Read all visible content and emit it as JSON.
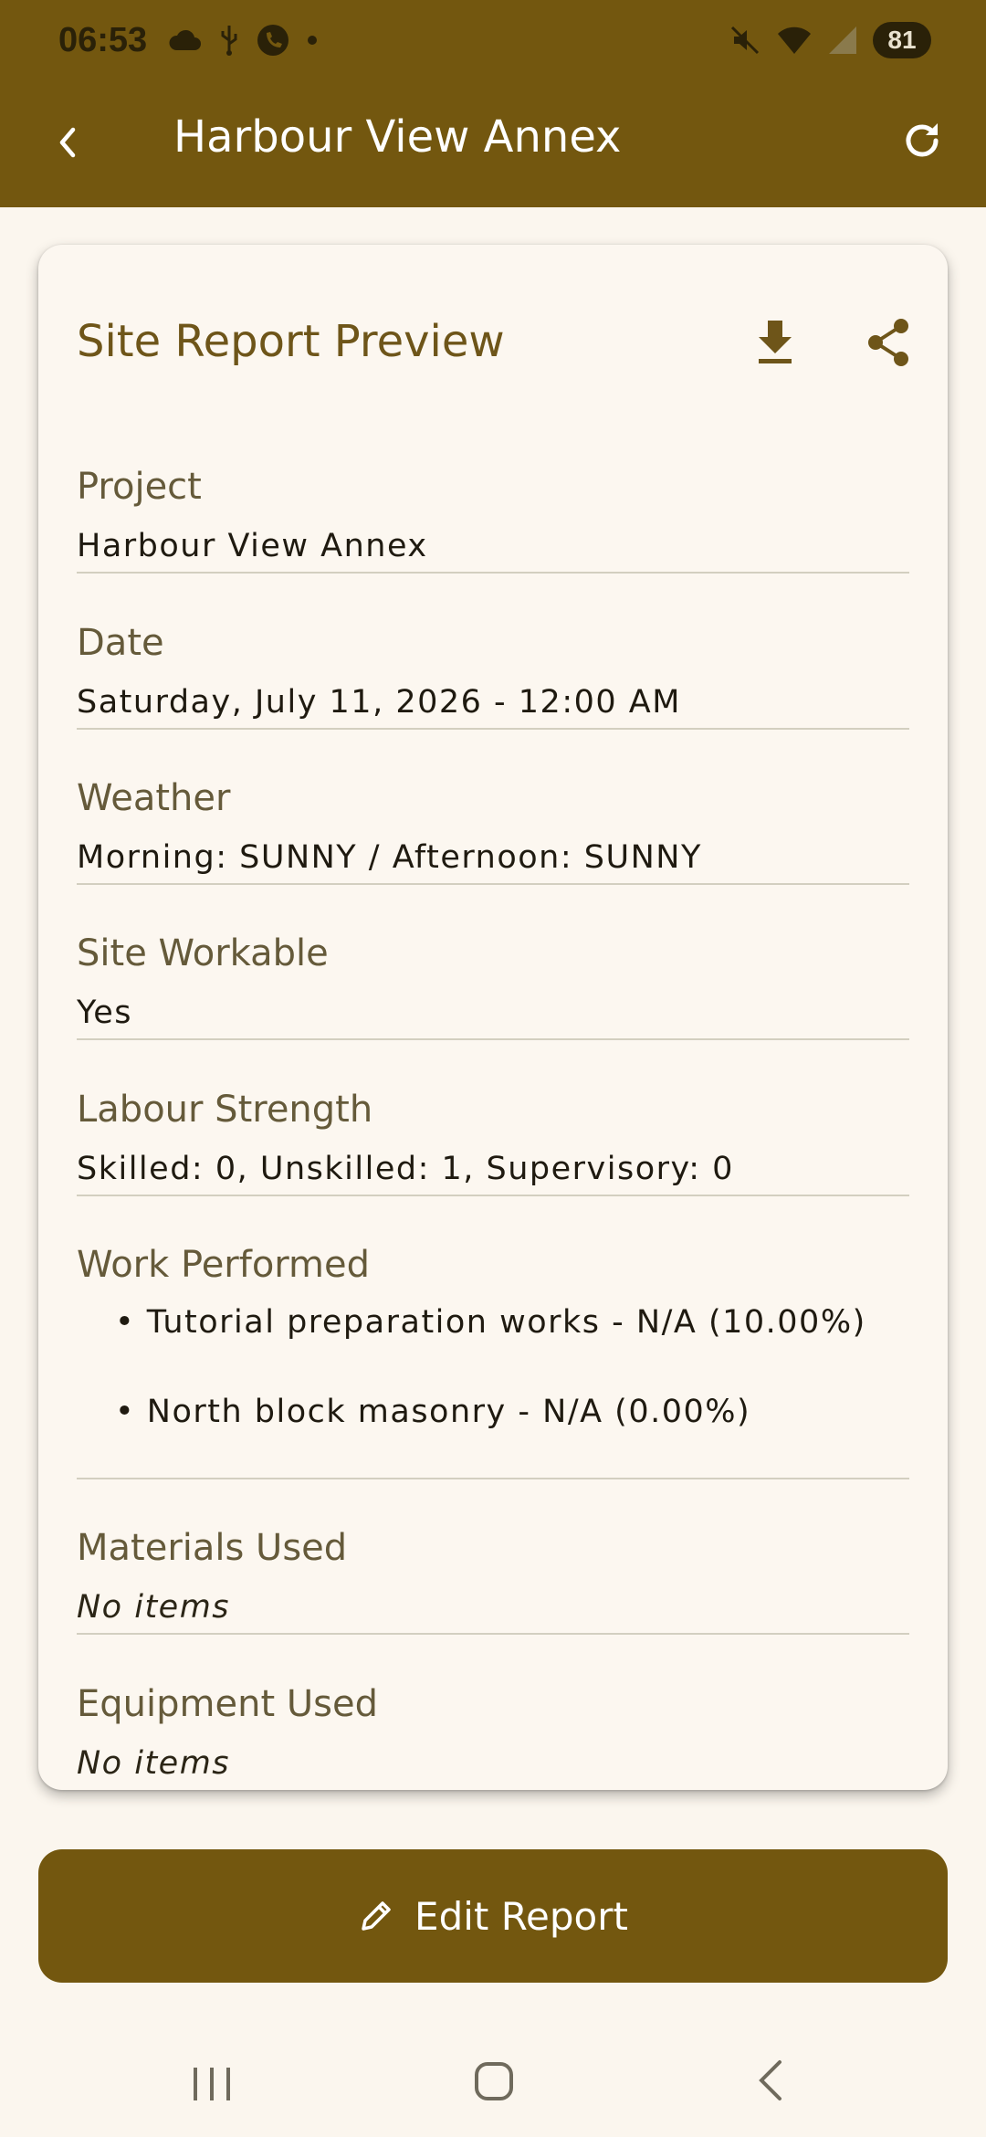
{
  "status_bar": {
    "time": "06:53",
    "battery": "81"
  },
  "app_bar": {
    "title": "Harbour View Annex"
  },
  "card": {
    "title": "Site Report Preview",
    "sections": {
      "project": {
        "label": "Project",
        "value": "Harbour View Annex"
      },
      "date": {
        "label": "Date",
        "value": "Saturday, July 11, 2026 - 12:00 AM"
      },
      "weather": {
        "label": "Weather",
        "value": "Morning: SUNNY / Afternoon: SUNNY"
      },
      "workable": {
        "label": "Site Workable",
        "value": "Yes"
      },
      "labour": {
        "label": "Labour Strength",
        "value": "Skilled: 0, Unskilled: 1, Supervisory: 0"
      },
      "work": {
        "label": "Work Performed",
        "items": [
          "• Tutorial preparation works - N/A (10.00%)",
          "• North block masonry - N/A (0.00%)"
        ]
      },
      "materials": {
        "label": "Materials Used",
        "value": "No items"
      },
      "equipment": {
        "label": "Equipment Used",
        "value": "No items"
      }
    }
  },
  "edit_button": {
    "label": "Edit Report"
  },
  "colors": {
    "primary": "#73570f",
    "background": "#fbf6ee",
    "label": "#655a3a",
    "title": "#6e5519"
  }
}
